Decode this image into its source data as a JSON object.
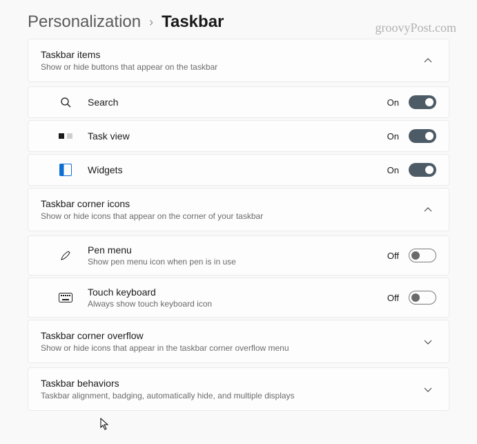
{
  "breadcrumb": {
    "parent": "Personalization",
    "current": "Taskbar"
  },
  "watermark": "groovyPost.com",
  "on_label": "On",
  "off_label": "Off",
  "sections": {
    "items": {
      "title": "Taskbar items",
      "subtitle": "Show or hide buttons that appear on the taskbar",
      "rows": [
        {
          "label": "Search",
          "state": "On"
        },
        {
          "label": "Task view",
          "state": "On"
        },
        {
          "label": "Widgets",
          "state": "On"
        }
      ]
    },
    "corner": {
      "title": "Taskbar corner icons",
      "subtitle": "Show or hide icons that appear on the corner of your taskbar",
      "rows": [
        {
          "label": "Pen menu",
          "sublabel": "Show pen menu icon when pen is in use",
          "state": "Off"
        },
        {
          "label": "Touch keyboard",
          "sublabel": "Always show touch keyboard icon",
          "state": "Off"
        }
      ]
    },
    "overflow": {
      "title": "Taskbar corner overflow",
      "subtitle": "Show or hide icons that appear in the taskbar corner overflow menu"
    },
    "behaviors": {
      "title": "Taskbar behaviors",
      "subtitle": "Taskbar alignment, badging, automatically hide, and multiple displays"
    }
  }
}
